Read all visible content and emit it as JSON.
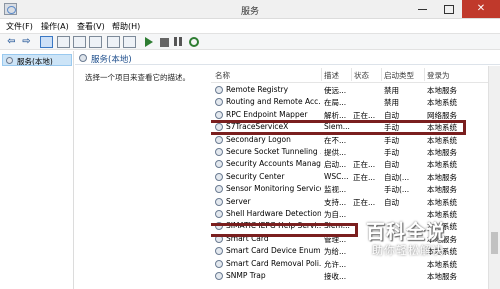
{
  "window": {
    "title": "服务",
    "close_glyph": "✕"
  },
  "menu": [
    "文件(F)",
    "操作(A)",
    "查看(V)",
    "帮助(H)"
  ],
  "toolbar": {
    "back_glyph": "⇦",
    "forward_glyph": "⇨",
    "icons": [
      "back-icon",
      "forward-icon",
      "console-tree-icon",
      "properties-icon",
      "refresh-icon",
      "export-icon",
      "help-icon",
      "view-icon",
      "start-icon",
      "stop-icon",
      "pause-icon",
      "restart-icon"
    ]
  },
  "tree": {
    "selected": "服务(本地)"
  },
  "panel": {
    "title": "服务(本地)",
    "description": "选择一个项目来查看它的描述。"
  },
  "columns": [
    "名称",
    "描述",
    "状态",
    "启动类型",
    "登录为"
  ],
  "rows": [
    {
      "name": "Remote Registry",
      "desc": "使远...",
      "status": "",
      "start": "禁用",
      "logon": "本地服务"
    },
    {
      "name": "Routing and Remote Acc...",
      "desc": "在局...",
      "status": "",
      "start": "禁用",
      "logon": "本地系统"
    },
    {
      "name": "RPC Endpoint Mapper",
      "desc": "解析...",
      "status": "正在...",
      "start": "自动",
      "logon": "网络服务"
    },
    {
      "name": "S7TraceServiceX",
      "desc": "Siem...",
      "status": "",
      "start": "手动",
      "logon": "本地系统"
    },
    {
      "name": "Secondary Logon",
      "desc": "在不...",
      "status": "",
      "start": "手动",
      "logon": "本地系统"
    },
    {
      "name": "Secure Socket Tunneling ...",
      "desc": "提供...",
      "status": "",
      "start": "手动",
      "logon": "本地服务"
    },
    {
      "name": "Security Accounts Manag...",
      "desc": "启动...",
      "status": "正在...",
      "start": "自动",
      "logon": "本地系统"
    },
    {
      "name": "Security Center",
      "desc": "WSC...",
      "status": "正在...",
      "start": "自动(...",
      "logon": "本地服务"
    },
    {
      "name": "Sensor Monitoring Service",
      "desc": "监视...",
      "status": "",
      "start": "手动(...",
      "logon": "本地服务"
    },
    {
      "name": "Server",
      "desc": "支持...",
      "status": "正在...",
      "start": "自动",
      "logon": "本地系统"
    },
    {
      "name": "Shell Hardware Detection",
      "desc": "为自...",
      "status": "",
      "start": "",
      "logon": "本地系统"
    },
    {
      "name": "SIMATIC IEPG Help Servi...",
      "desc": "Siem...",
      "status": "",
      "start": "",
      "logon": "本地系统"
    },
    {
      "name": "Smart Card",
      "desc": "管理...",
      "status": "",
      "start": "",
      "logon": "本地服务"
    },
    {
      "name": "Smart Card Device Enum...",
      "desc": "为给...",
      "status": "",
      "start": "",
      "logon": "本地系统"
    },
    {
      "name": "Smart Card Removal Poli...",
      "desc": "允许...",
      "status": "",
      "start": "",
      "logon": "本地系统"
    },
    {
      "name": "SNMP Trap",
      "desc": "接收...",
      "status": "",
      "start": "",
      "logon": "本地服务"
    }
  ],
  "watermark": {
    "title": "百科全说",
    "subtitle": "助你轻松解决"
  },
  "colors": {
    "highlight": "#7a1f1f",
    "selection": "#cce4f7",
    "close": "#c0392b"
  }
}
